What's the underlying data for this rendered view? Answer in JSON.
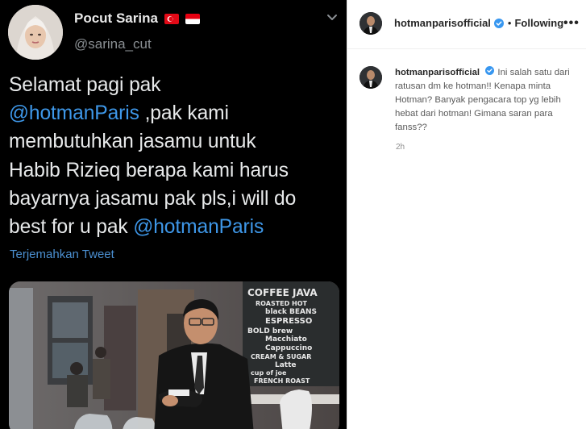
{
  "tweet": {
    "author_name": "Pocut Sarina",
    "handle": "@sarina_cut",
    "text_lines": [
      "Selamat pagi pak",
      "@hotmanParis",
      " ,pak kami",
      "membutuhkan jasamu untuk",
      "Habib Rizieq berapa kami harus",
      "bayarnya jasamu pak pls,i will do",
      "best for u pak ",
      "@hotmanParis"
    ],
    "translate_link": "Terjemahkan Tweet",
    "photo_signage": [
      "COFFEE JAVA",
      "ROASTED HOT",
      "black BEANS",
      "ESPRESSO",
      "BOLD brew",
      "Macchiato",
      "Cappuccino",
      "CREAM & SUGAR",
      "Latte",
      "cup of joe",
      "FRENCH ROAST"
    ]
  },
  "instagram": {
    "header_username": "hotmanparisofficial",
    "separator": "•",
    "following_label": "Following",
    "more_label": "•••",
    "caption_username": "hotmanparisofficial",
    "caption_text": "Ini salah satu dari ratusan dm ke hotman!! Kenapa minta Hotman? Banyak pengacara top yg lebih hebat dari hotman! Gimana saran para fanss??",
    "timestamp": "2h",
    "verified_color": "#3897f0"
  }
}
